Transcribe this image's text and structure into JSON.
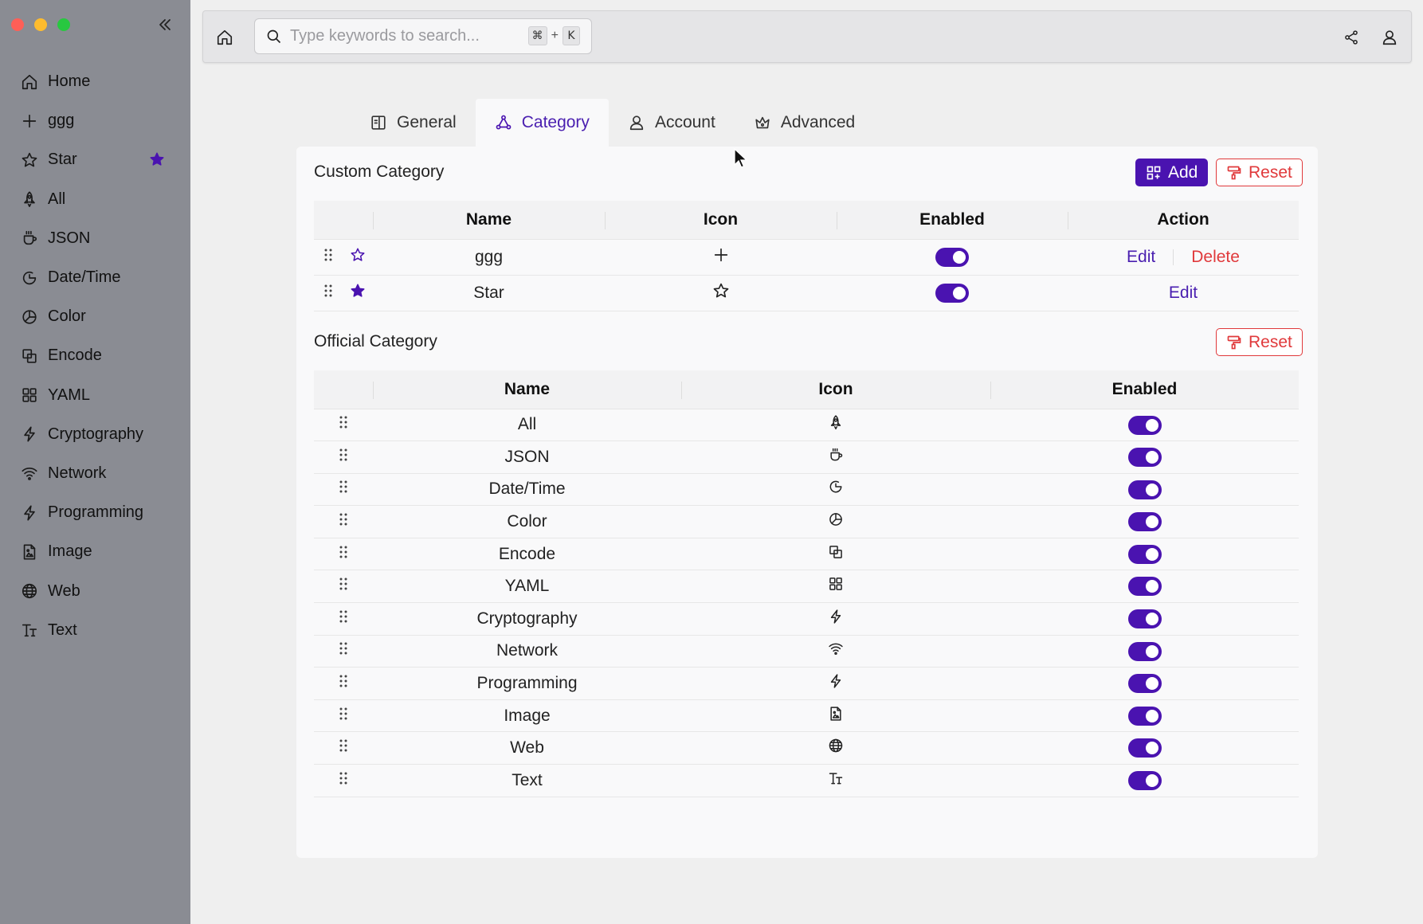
{
  "window": {
    "traffic_colors": [
      "#fe5f57",
      "#febc2e",
      "#28c840"
    ]
  },
  "sidebar": {
    "items": [
      {
        "label": "Home",
        "icon": "home-icon"
      },
      {
        "label": "ggg",
        "icon": "plus-icon"
      },
      {
        "label": "Star",
        "icon": "star-icon",
        "starred": true
      },
      {
        "label": "All",
        "icon": "rocket-icon"
      },
      {
        "label": "JSON",
        "icon": "coffee-icon"
      },
      {
        "label": "Date/Time",
        "icon": "clock-icon"
      },
      {
        "label": "Color",
        "icon": "pie-icon"
      },
      {
        "label": "Encode",
        "icon": "copy-icon"
      },
      {
        "label": "YAML",
        "icon": "grid-icon"
      },
      {
        "label": "Cryptography",
        "icon": "bolt-icon"
      },
      {
        "label": "Network",
        "icon": "wifi-icon"
      },
      {
        "label": "Programming",
        "icon": "bolt-icon"
      },
      {
        "label": "Image",
        "icon": "file-image-icon"
      },
      {
        "label": "Web",
        "icon": "globe-icon"
      },
      {
        "label": "Text",
        "icon": "text-size-icon"
      }
    ]
  },
  "search": {
    "placeholder": "Type keywords to search...",
    "shortcut_key1": "⌘",
    "shortcut_plus": "+",
    "shortcut_key2": "K"
  },
  "tabs": [
    {
      "label": "General",
      "icon": "general-icon"
    },
    {
      "label": "Category",
      "icon": "category-icon",
      "active": true
    },
    {
      "label": "Account",
      "icon": "user-icon"
    },
    {
      "label": "Advanced",
      "icon": "crown-icon"
    }
  ],
  "custom": {
    "title": "Custom Category",
    "add_label": "Add",
    "reset_label": "Reset",
    "columns": [
      "Name",
      "Icon",
      "Enabled",
      "Action"
    ],
    "rows": [
      {
        "name": "ggg",
        "icon": "plus-icon",
        "starred": false,
        "enabled": true,
        "actions": [
          "Edit",
          "Delete"
        ]
      },
      {
        "name": "Star",
        "icon": "star-icon",
        "starred": true,
        "enabled": true,
        "actions": [
          "Edit"
        ]
      }
    ]
  },
  "official": {
    "title": "Official Category",
    "reset_label": "Reset",
    "columns": [
      "Name",
      "Icon",
      "Enabled"
    ],
    "rows": [
      {
        "name": "All",
        "icon": "rocket-icon",
        "enabled": true
      },
      {
        "name": "JSON",
        "icon": "coffee-icon",
        "enabled": true
      },
      {
        "name": "Date/Time",
        "icon": "clock-icon",
        "enabled": true
      },
      {
        "name": "Color",
        "icon": "pie-icon",
        "enabled": true
      },
      {
        "name": "Encode",
        "icon": "copy-icon",
        "enabled": true
      },
      {
        "name": "YAML",
        "icon": "grid-icon",
        "enabled": true
      },
      {
        "name": "Cryptography",
        "icon": "bolt-icon",
        "enabled": true
      },
      {
        "name": "Network",
        "icon": "wifi-icon",
        "enabled": true
      },
      {
        "name": "Programming",
        "icon": "bolt-icon",
        "enabled": true
      },
      {
        "name": "Image",
        "icon": "file-image-icon",
        "enabled": true
      },
      {
        "name": "Web",
        "icon": "globe-icon",
        "enabled": true
      },
      {
        "name": "Text",
        "icon": "text-size-icon",
        "enabled": true
      }
    ]
  },
  "colors": {
    "accent": "#4a13b0",
    "danger": "#e0393b",
    "sidebar_bg": "#8a8c93"
  }
}
